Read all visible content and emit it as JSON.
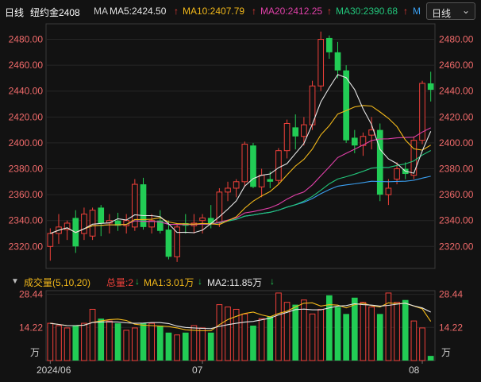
{
  "header": {
    "period": "日线",
    "symbol": "纽约金2408",
    "ma_label": "MA",
    "ma5": "MA5:2424.50",
    "ma10": "MA10:2407.79",
    "ma20": "MA20:2412.25",
    "ma30": "MA30:2390.68",
    "arrow_up": "↑",
    "m_button": "M",
    "period_select": "日线",
    "chevron": "⌄"
  },
  "colors": {
    "up": "#f0403a",
    "down": "#22cc55",
    "ma5": "#e6e6e6",
    "ma10": "#f2b81a",
    "ma20": "#e040a8",
    "ma30": "#22c47a",
    "ma60": "#3a9ff0",
    "axis_text": "#f06a6a"
  },
  "volume_header": {
    "title": "成交量(5,10,20)",
    "total": "总量:2",
    "ma1": "MA1:3.01万",
    "ma2": "MA2:11.85万",
    "arrow_down": "↓"
  },
  "x_axis": {
    "labels": [
      "2024/06",
      "07",
      "08"
    ]
  },
  "chart_data": [
    {
      "type": "candlestick",
      "y_ticks": [
        "2480.00",
        "2460.00",
        "2440.00",
        "2420.00",
        "2400.00",
        "2380.00",
        "2360.00",
        "2340.00",
        "2320.00"
      ],
      "ylim": [
        2303,
        2492
      ],
      "candles": [
        {
          "o": 2320,
          "h": 2334,
          "l": 2309,
          "c": 2330
        },
        {
          "o": 2330,
          "h": 2345,
          "l": 2322,
          "c": 2335
        },
        {
          "o": 2333,
          "h": 2340,
          "l": 2325,
          "c": 2338
        },
        {
          "o": 2342,
          "h": 2348,
          "l": 2315,
          "c": 2320
        },
        {
          "o": 2330,
          "h": 2350,
          "l": 2325,
          "c": 2345
        },
        {
          "o": 2328,
          "h": 2350,
          "l": 2325,
          "c": 2348
        },
        {
          "o": 2350,
          "h": 2352,
          "l": 2328,
          "c": 2338
        },
        {
          "o": 2338,
          "h": 2345,
          "l": 2330,
          "c": 2340
        },
        {
          "o": 2340,
          "h": 2346,
          "l": 2332,
          "c": 2336
        },
        {
          "o": 2336,
          "h": 2345,
          "l": 2330,
          "c": 2340
        },
        {
          "o": 2335,
          "h": 2372,
          "l": 2332,
          "c": 2368
        },
        {
          "o": 2368,
          "h": 2373,
          "l": 2333,
          "c": 2335
        },
        {
          "o": 2335,
          "h": 2345,
          "l": 2330,
          "c": 2340
        },
        {
          "o": 2340,
          "h": 2348,
          "l": 2330,
          "c": 2332
        },
        {
          "o": 2333,
          "h": 2340,
          "l": 2310,
          "c": 2312
        },
        {
          "o": 2312,
          "h": 2338,
          "l": 2308,
          "c": 2335
        },
        {
          "o": 2338,
          "h": 2345,
          "l": 2330,
          "c": 2336
        },
        {
          "o": 2336,
          "h": 2345,
          "l": 2330,
          "c": 2338
        },
        {
          "o": 2340,
          "h": 2345,
          "l": 2330,
          "c": 2342
        },
        {
          "o": 2342,
          "h": 2352,
          "l": 2334,
          "c": 2337
        },
        {
          "o": 2338,
          "h": 2365,
          "l": 2335,
          "c": 2362
        },
        {
          "o": 2362,
          "h": 2370,
          "l": 2355,
          "c": 2365
        },
        {
          "o": 2365,
          "h": 2372,
          "l": 2358,
          "c": 2370
        },
        {
          "o": 2370,
          "h": 2401,
          "l": 2366,
          "c": 2399
        },
        {
          "o": 2398,
          "h": 2400,
          "l": 2365,
          "c": 2366
        },
        {
          "o": 2366,
          "h": 2380,
          "l": 2358,
          "c": 2375
        },
        {
          "o": 2372,
          "h": 2378,
          "l": 2365,
          "c": 2370
        },
        {
          "o": 2371,
          "h": 2396,
          "l": 2368,
          "c": 2394
        },
        {
          "o": 2394,
          "h": 2418,
          "l": 2388,
          "c": 2415
        },
        {
          "o": 2412,
          "h": 2422,
          "l": 2395,
          "c": 2405
        },
        {
          "o": 2405,
          "h": 2420,
          "l": 2398,
          "c": 2414
        },
        {
          "o": 2414,
          "h": 2448,
          "l": 2410,
          "c": 2444
        },
        {
          "o": 2444,
          "h": 2486,
          "l": 2440,
          "c": 2480
        },
        {
          "o": 2481,
          "h": 2483,
          "l": 2465,
          "c": 2470
        },
        {
          "o": 2470,
          "h": 2478,
          "l": 2450,
          "c": 2456
        },
        {
          "o": 2456,
          "h": 2460,
          "l": 2400,
          "c": 2402
        },
        {
          "o": 2404,
          "h": 2410,
          "l": 2392,
          "c": 2398
        },
        {
          "o": 2398,
          "h": 2408,
          "l": 2390,
          "c": 2405
        },
        {
          "o": 2406,
          "h": 2420,
          "l": 2395,
          "c": 2410
        },
        {
          "o": 2410,
          "h": 2415,
          "l": 2355,
          "c": 2360
        },
        {
          "o": 2360,
          "h": 2372,
          "l": 2352,
          "c": 2365
        },
        {
          "o": 2372,
          "h": 2385,
          "l": 2368,
          "c": 2380
        },
        {
          "o": 2380,
          "h": 2385,
          "l": 2372,
          "c": 2376
        },
        {
          "o": 2375,
          "h": 2405,
          "l": 2372,
          "c": 2402
        },
        {
          "o": 2402,
          "h": 2448,
          "l": 2399,
          "c": 2446
        },
        {
          "o": 2446,
          "h": 2455,
          "l": 2432,
          "c": 2441
        }
      ]
    },
    {
      "type": "bar",
      "y_ticks": [
        "28.44",
        "14.22",
        "万"
      ],
      "ylim": [
        0,
        30
      ],
      "unit": "万",
      "values": [
        16,
        15,
        14,
        15,
        16,
        22,
        18,
        17,
        16,
        13,
        14,
        16,
        16,
        15,
        12,
        11,
        12,
        15,
        14,
        12,
        24,
        23,
        22,
        20,
        15,
        18,
        19,
        29,
        25,
        24,
        26,
        20,
        22,
        28,
        23,
        20,
        27,
        25,
        23,
        20,
        29,
        25,
        26,
        17,
        14,
        2
      ]
    }
  ]
}
